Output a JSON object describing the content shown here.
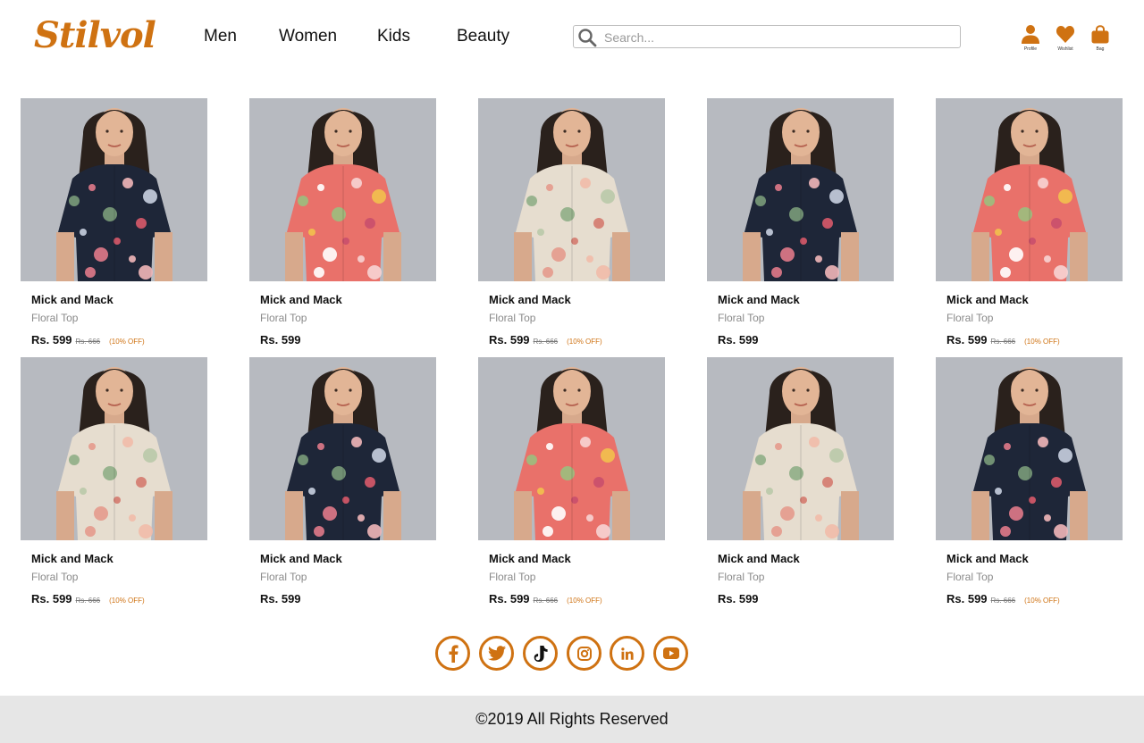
{
  "header": {
    "logo": "Stilvol",
    "nav": {
      "men": "Men",
      "women": "Women",
      "kids": "Kids",
      "beauty": "Beauty"
    },
    "search_placeholder": "Search...",
    "icons": {
      "profile_label": "Profile",
      "wishlist_label": "Wishlist",
      "bag_label": "Bag"
    }
  },
  "colors": {
    "accent": "#cf7212",
    "navy": "#1e2638",
    "coral": "#e9716a",
    "cream": "#e6ddcf"
  },
  "products": [
    {
      "brand": "Mick and Mack",
      "name": "Floral Top",
      "price": "Rs. 599",
      "mrp": "Rs. 666",
      "discount": "(10% OFF)",
      "pattern": "navy"
    },
    {
      "brand": "Mick and Mack",
      "name": "Floral Top",
      "price": "Rs. 599",
      "mrp": "",
      "discount": "",
      "pattern": "coral"
    },
    {
      "brand": "Mick and Mack",
      "name": "Floral Top",
      "price": "Rs. 599",
      "mrp": "Rs. 666",
      "discount": "(10% OFF)",
      "pattern": "cream"
    },
    {
      "brand": "Mick and Mack",
      "name": "Floral Top",
      "price": "Rs. 599",
      "mrp": "",
      "discount": "",
      "pattern": "navy"
    },
    {
      "brand": "Mick and Mack",
      "name": "Floral Top",
      "price": "Rs. 599",
      "mrp": "Rs. 666",
      "discount": "(10% OFF)",
      "pattern": "coral"
    },
    {
      "brand": "Mick and Mack",
      "name": "Floral Top",
      "price": "Rs. 599",
      "mrp": "Rs. 666",
      "discount": "(10% OFF)",
      "pattern": "cream"
    },
    {
      "brand": "Mick and Mack",
      "name": "Floral Top",
      "price": "Rs. 599",
      "mrp": "",
      "discount": "",
      "pattern": "navy"
    },
    {
      "brand": "Mick and Mack",
      "name": "Floral Top",
      "price": "Rs. 599",
      "mrp": "Rs. 666",
      "discount": "(10% OFF)",
      "pattern": "coral"
    },
    {
      "brand": "Mick and Mack",
      "name": "Floral Top",
      "price": "Rs. 599",
      "mrp": "",
      "discount": "",
      "pattern": "cream"
    },
    {
      "brand": "Mick and Mack",
      "name": "Floral Top",
      "price": "Rs. 599",
      "mrp": "Rs. 666",
      "discount": "(10% OFF)",
      "pattern": "navy"
    }
  ],
  "social": [
    "facebook-icon",
    "twitter-icon",
    "tiktok-icon",
    "instagram-icon",
    "linkedin-icon",
    "youtube-icon"
  ],
  "footer": {
    "copyright": "©2019 All Rights Reserved"
  }
}
